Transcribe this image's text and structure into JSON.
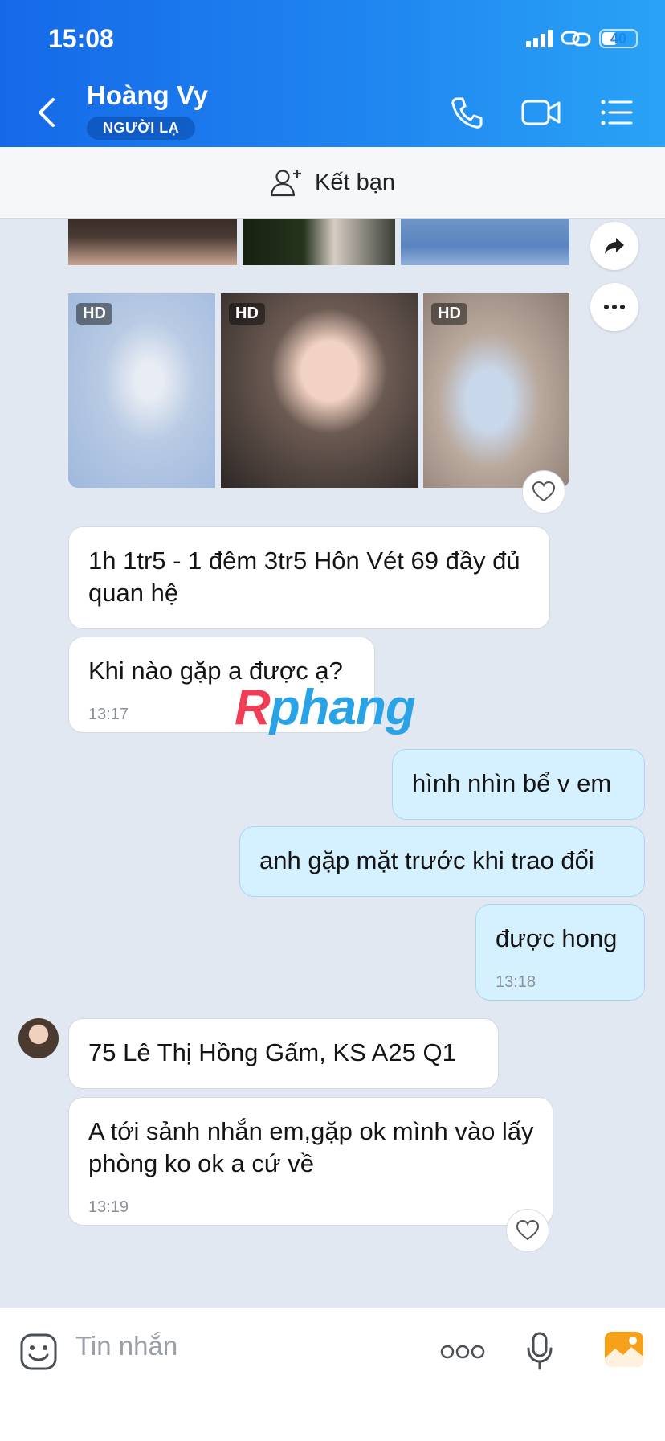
{
  "status_bar": {
    "time": "15:08",
    "battery": "40",
    "battery_level": 0.4
  },
  "header": {
    "contact_name": "Hoàng Vy",
    "badge": "NGƯỜI LẠ"
  },
  "add_friend": {
    "label": "Kết bạn"
  },
  "photos": {
    "hd_label": "HD"
  },
  "messages": [
    {
      "direction": "in",
      "text": "1h 1tr5 - 1 đêm 3tr5 Hôn Vét 69 đầy đủ quan hệ",
      "time": ""
    },
    {
      "direction": "in",
      "text": "Khi nào gặp a được ạ?",
      "time": "13:17"
    },
    {
      "direction": "out",
      "text": "hình nhìn bể v em",
      "time": ""
    },
    {
      "direction": "out",
      "text": "anh gặp mặt trước khi trao đổi",
      "time": ""
    },
    {
      "direction": "out",
      "text": "được hong",
      "time": "13:18"
    },
    {
      "direction": "in",
      "text": "75 Lê Thị Hồng Gấm, KS A25 Q1",
      "time": ""
    },
    {
      "direction": "in",
      "text": "A tới sảnh nhắn em,gặp ok mình vào lấy phòng ko ok a cứ về",
      "time": "13:19"
    }
  ],
  "watermark": {
    "part1": "R",
    "part2": "phang"
  },
  "input": {
    "placeholder": "Tin nhắn"
  }
}
